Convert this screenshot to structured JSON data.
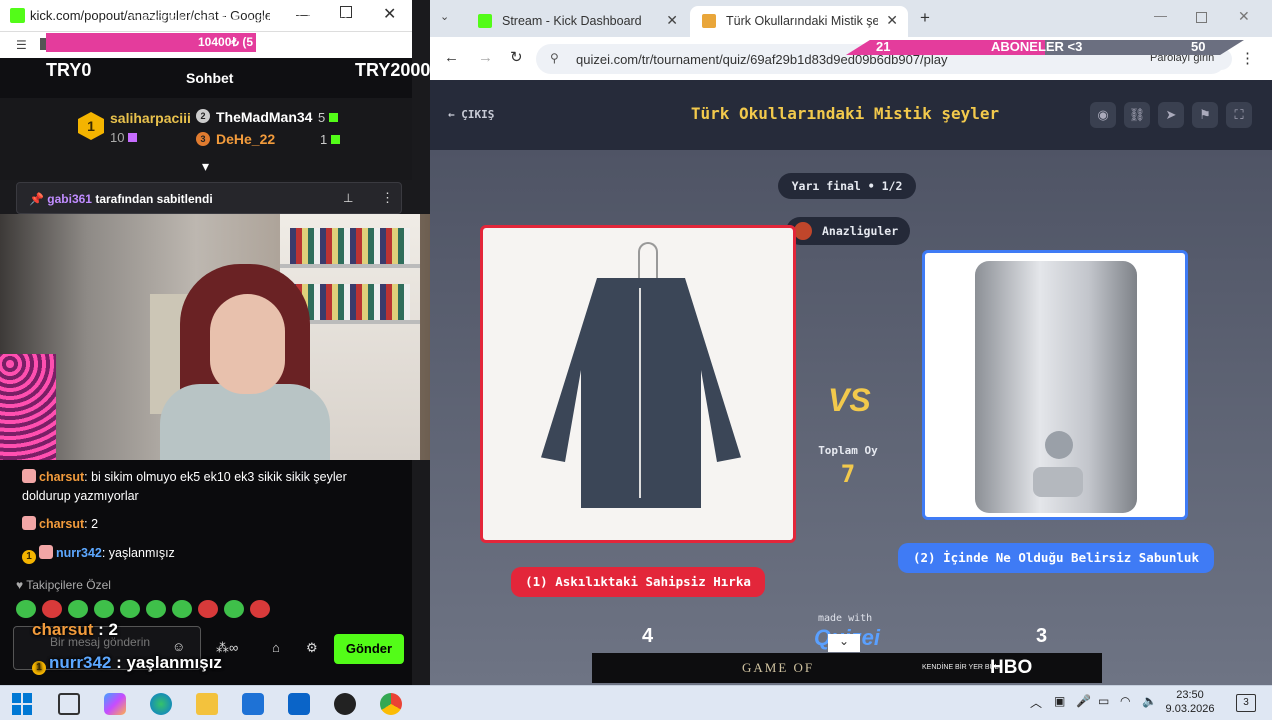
{
  "left_window": {
    "title": "kick.com/popout/anazliguler/chat - Google Chro...",
    "overlay_banner": "DESTEKLER VE ABONELER <3",
    "sub_goal": "10400₺ (5",
    "leaderboard": {
      "left": "TRY0",
      "center": "Sohbet",
      "right": "TRY2000"
    },
    "gifters": [
      {
        "rank": "1",
        "name": "saliharpaciii",
        "count": "10"
      },
      {
        "rank": "2",
        "name": "TheMadMan34",
        "count": "5"
      },
      {
        "rank": "3",
        "name": "DeHe_22",
        "count": "1"
      }
    ],
    "pinned": {
      "user": "gabi361",
      "text": "tarafından sabitlendi"
    },
    "chat": [
      {
        "user": "charsut",
        "text": ": bi sikim olmuyo ek5 ek10 ek3 sikik sikik şeyler doldurup yazmıyorlar"
      },
      {
        "user": "charsut",
        "text": ": 2"
      },
      {
        "user": "nurr342",
        "text": ": yaşlanmışız"
      }
    ],
    "followers_only": "Takipçilere Özel",
    "input_placeholder": "Bir mesaj gönderin",
    "send_label": "Gönder",
    "overlay_chat": [
      {
        "user": "charsut",
        "text": " : 2"
      },
      {
        "user": "nurr342",
        "text": " : yaşlanmışız"
      }
    ]
  },
  "right_window": {
    "tabs": [
      {
        "label": "Stream - Kick Dashboard"
      },
      {
        "label": "Türk Okullarındaki Mistik şeyler"
      }
    ],
    "url": "quizei.com/tr/tournament/quiz/69af29b1d83d9ed09b6db907/play",
    "password_label": "Parolayı girin",
    "overlay_bar": {
      "left": "21",
      "middle": "ABONELER <3",
      "right": "50"
    },
    "quiz": {
      "back": "ÇIKIŞ",
      "title": "Türk Okullarındaki Mistik şeyler",
      "round": "Yarı final • 1/2",
      "author": "Anazliguler",
      "vs": "VS",
      "total_label": "Toplam Oy",
      "total_votes": "7",
      "option1": "(1) Askılıktaki Sahipsiz Hırka",
      "option2": "(2) İçinde Ne Olduğu Belirsiz Sabunluk",
      "made_with": "made with",
      "brand": "Quizei",
      "score_left": "4",
      "score_right": "3"
    },
    "ad": {
      "game": "GAME OF",
      "slogan": "KENDİNE BİR YER BUL",
      "network": "HBO"
    }
  },
  "taskbar": {
    "time": "23:50",
    "date": "9.03.2026",
    "notifications": "3"
  },
  "colors": {
    "kick_green": "#53fc18",
    "quiz_red": "#e3263a",
    "quiz_blue": "#3f7bf5",
    "quiz_gold": "#f2c94c",
    "overlay_pink": "#e43c9c"
  }
}
